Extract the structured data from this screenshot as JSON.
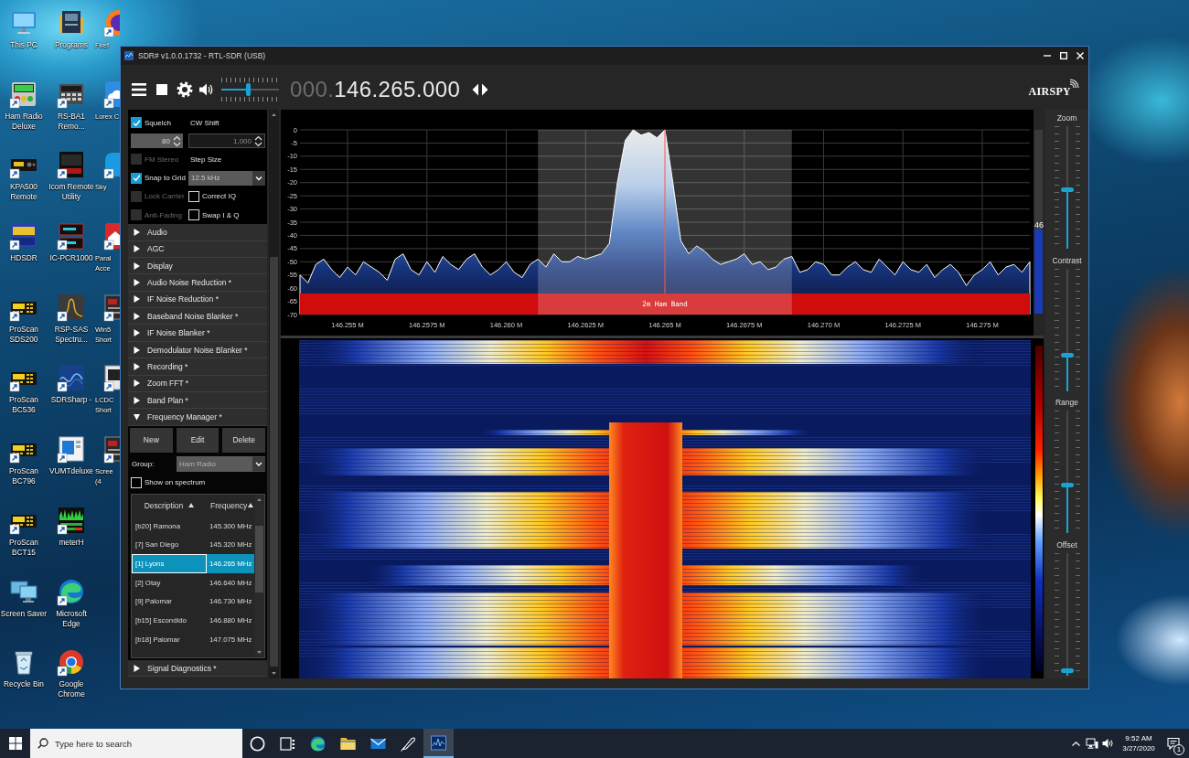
{
  "desktop": {
    "columns": [
      {
        "icons": [
          {
            "label": "This PC",
            "kind": "monitor",
            "shortcut": false
          },
          {
            "label": "Ham Radio Deluxe",
            "kind": "radio",
            "shortcut": true
          },
          {
            "label": "KPA500 Remote",
            "kind": "amplifier",
            "shortcut": true
          },
          {
            "label": "HDSDR",
            "kind": "hd_tile",
            "shortcut": true
          },
          {
            "label": "ProScan SDS200",
            "kind": "scanner",
            "shortcut": true
          },
          {
            "label": "ProScan BC536",
            "kind": "scanner",
            "shortcut": true
          },
          {
            "label": "ProScan BC796",
            "kind": "scanner",
            "shortcut": true
          },
          {
            "label": "ProScan BCT15",
            "kind": "scanner",
            "shortcut": true
          },
          {
            "label": "Screen Saver",
            "kind": "screens",
            "shortcut": false
          },
          {
            "label": "Recycle Bin",
            "kind": "bin",
            "shortcut": false
          }
        ]
      },
      {
        "icons": [
          {
            "label": "Programs",
            "kind": "folder",
            "shortcut": false
          },
          {
            "label": "RS-BA1 Remo...",
            "kind": "rack",
            "shortcut": true
          },
          {
            "label": "Icom Remote Utility",
            "kind": "remote_tile",
            "shortcut": true
          },
          {
            "label": "IC-PCR1000",
            "kind": "stack",
            "shortcut": true
          },
          {
            "label": "RSP-SAS Spectru...",
            "kind": "peak",
            "shortcut": true
          },
          {
            "label": "SDRSharp -",
            "kind": "wave",
            "shortcut": true
          },
          {
            "label": "VUMTdeluxe",
            "kind": "window",
            "shortcut": true
          },
          {
            "label": "meterH",
            "kind": "meter",
            "shortcut": true
          },
          {
            "label": "Microsoft Edge",
            "kind": "swirl",
            "shortcut": true
          },
          {
            "label": "Google Chrome",
            "kind": "ring",
            "shortcut": true
          }
        ]
      },
      {
        "icons": [
          {
            "label": "Firef",
            "kind": "fox",
            "shortcut": true
          },
          {
            "label": "Lorex C",
            "kind": "cloud",
            "shortcut": true
          },
          {
            "label": "Sky",
            "kind": "chat",
            "shortcut": true
          },
          {
            "label": "Paral Acce",
            "kind": "house",
            "shortcut": true
          },
          {
            "label": "Win5 Short",
            "kind": "dark",
            "shortcut": true
          },
          {
            "label": "LCDC Short",
            "kind": "lcd",
            "shortcut": true
          },
          {
            "label": "Scree (4",
            "kind": "dark",
            "shortcut": true
          }
        ]
      }
    ]
  },
  "window": {
    "title": "SDR# v1.0.0.1732 - RTL-SDR (USB)"
  },
  "toolbar": {
    "volume": {
      "level": 0.47
    },
    "frequency": {
      "prefix": "000.",
      "value": "146.265.000"
    },
    "logo": "AIRSPY"
  },
  "side_panel": {
    "demodulator": [
      {
        "kind": "checkbox",
        "label": "Squelch",
        "checked": true,
        "disabled": false
      },
      {
        "kind": "label",
        "text": "CW Shift"
      },
      {
        "kind": "spinner",
        "value": "80",
        "disabled": false
      },
      {
        "kind": "spinner",
        "value": "1,000",
        "disabled": true
      },
      {
        "kind": "checkbox",
        "label": "FM Stereo",
        "checked": false,
        "disabled": true
      },
      {
        "kind": "label",
        "text": "Step Size"
      },
      {
        "kind": "checkbox",
        "label": "Snap to Grid",
        "checked": true,
        "disabled": false
      },
      {
        "kind": "dropdown",
        "value": "12.5 kHz"
      },
      {
        "kind": "checkbox",
        "label": "Lock Carrier",
        "checked": false,
        "disabled": true
      },
      {
        "kind": "checkbox",
        "label": "Correct IQ",
        "checked": false,
        "disabled": false
      },
      {
        "kind": "checkbox",
        "label": "Anti-Fading",
        "checked": false,
        "disabled": true
      },
      {
        "kind": "checkbox",
        "label": "Swap I & Q",
        "checked": false,
        "disabled": false
      }
    ],
    "sections": [
      {
        "label": "Audio",
        "expanded": false
      },
      {
        "label": "AGC",
        "expanded": false
      },
      {
        "label": "Display",
        "expanded": false
      },
      {
        "label": "Audio Noise Reduction *",
        "expanded": false
      },
      {
        "label": "IF Noise Reduction *",
        "expanded": false
      },
      {
        "label": "Baseband Noise Blanker *",
        "expanded": false
      },
      {
        "label": "IF Noise Blanker *",
        "expanded": false
      },
      {
        "label": "Demodulator Noise Blanker *",
        "expanded": false
      },
      {
        "label": "Recording *",
        "expanded": false
      },
      {
        "label": "Zoom FFT *",
        "expanded": false
      },
      {
        "label": "Band Plan *",
        "expanded": false
      },
      {
        "label": "Frequency Manager *",
        "expanded": true,
        "body": {
          "buttons": [
            "New",
            "Edit",
            "Delete"
          ],
          "group": {
            "label": "Group:",
            "value": "Ham Radio"
          },
          "show_on_spectrum": {
            "label": "Show on spectrum",
            "checked": false
          },
          "table": {
            "columns": [
              {
                "label": "Description",
                "sorted": true
              },
              {
                "label": "Frequency",
                "sorted": true
              }
            ],
            "rows": [
              {
                "cells": [
                  "[b20] Ramona",
                  "145.300 MHz"
                ],
                "selected": false
              },
              {
                "cells": [
                  "[7] San Diego",
                  "145.320 MHz"
                ],
                "selected": false
              },
              {
                "cells": [
                  "[1] Lyons",
                  "146.265 MHz"
                ],
                "selected": true
              },
              {
                "cells": [
                  "[2] Otay",
                  "146.640 MHz"
                ],
                "selected": false
              },
              {
                "cells": [
                  "[9] Palomar",
                  "146.730 MHz"
                ],
                "selected": false
              },
              {
                "cells": [
                  "[b15] Escondido",
                  "146.880 MHz"
                ],
                "selected": false
              },
              {
                "cells": [
                  "[b18] Palomar",
                  "147.075 MHz"
                ],
                "selected": false
              }
            ]
          }
        }
      },
      {
        "label": "Signal Diagnostics *",
        "expanded": false
      }
    ]
  },
  "spectrum": {
    "chart_data": {
      "type": "area",
      "grid": true,
      "xlim": [
        146.2535,
        146.2765
      ],
      "ylim": [
        -70,
        0
      ],
      "xticks": [
        {
          "value": 146.255,
          "label": "146.255 M"
        },
        {
          "value": 146.2575,
          "label": "146.2575 M"
        },
        {
          "value": 146.26,
          "label": "146.260 M"
        },
        {
          "value": 146.2625,
          "label": "146.2625 M"
        },
        {
          "value": 146.265,
          "label": "146.265 M"
        },
        {
          "value": 146.2675,
          "label": "146.2675 M"
        },
        {
          "value": 146.27,
          "label": "146.270 M"
        },
        {
          "value": 146.2725,
          "label": "146.2725 M"
        },
        {
          "value": 146.275,
          "label": "146.275 M"
        }
      ],
      "yticks": [
        0,
        -5,
        -10,
        -15,
        -20,
        -25,
        -30,
        -35,
        -40,
        -45,
        -50,
        -55,
        -60,
        -65,
        -70
      ],
      "x": [
        146.2535,
        146.2535,
        146.25375,
        146.254,
        146.25425,
        146.2545,
        146.25475,
        146.255,
        146.25525,
        146.2555,
        146.25575,
        146.256,
        146.25625,
        146.2565,
        146.25675,
        146.257,
        146.25725,
        146.2575,
        146.25775,
        146.258,
        146.25825,
        146.2585,
        146.25875,
        146.259,
        146.25925,
        146.2595,
        146.25975,
        146.26,
        146.26025,
        146.2605,
        146.26075,
        146.261,
        146.26125,
        146.2615,
        146.26175,
        146.262,
        146.26225,
        146.2625,
        146.26275,
        146.263,
        146.26325,
        146.2635,
        146.26375,
        146.264,
        146.26425,
        146.2645,
        146.26475,
        146.265,
        146.26525,
        146.2655,
        146.26575,
        146.266,
        146.26625,
        146.2665,
        146.26675,
        146.267,
        146.26725,
        146.2675,
        146.26775,
        146.268,
        146.26825,
        146.2685,
        146.26875,
        146.269,
        146.26925,
        146.2695,
        146.26975,
        146.27,
        146.27025,
        146.2705,
        146.27075,
        146.271,
        146.27125,
        146.2715,
        146.27175,
        146.272,
        146.27225,
        146.2725,
        146.27275,
        146.273,
        146.27325,
        146.2735,
        146.27375,
        146.274,
        146.27425,
        146.2745,
        146.27475,
        146.275,
        146.27525,
        146.2755,
        146.27575,
        146.276,
        146.27625,
        146.2765,
        146.2765
      ],
      "series": [
        {
          "color": "#ffffff",
          "values": [
            -70,
            -55,
            -58,
            -51,
            -49,
            -53,
            -56,
            -52,
            -55,
            -50,
            -52,
            -54,
            -57,
            -49,
            -47,
            -53,
            -55,
            -50,
            -54,
            -48,
            -51,
            -53,
            -49,
            -47,
            -52,
            -55,
            -53,
            -50,
            -54,
            -56,
            -51,
            -49,
            -52,
            -47,
            -50,
            -50,
            -48,
            -49,
            -48,
            -47,
            -43,
            -20,
            -4,
            0,
            -2,
            -1,
            -3,
            0,
            -20,
            -42,
            -47,
            -44,
            -46,
            -49,
            -51,
            -50,
            -49,
            -47,
            -51,
            -50,
            -53,
            -52,
            -49,
            -48,
            -54,
            -53,
            -50,
            -51,
            -55,
            -55,
            -52,
            -50,
            -53,
            -54,
            -49,
            -52,
            -55,
            -50,
            -53,
            -54,
            -51,
            -56,
            -53,
            -51,
            -54,
            -59,
            -55,
            -53,
            -50,
            -55,
            -52,
            -51,
            -54,
            -50,
            -70
          ]
        }
      ],
      "ref_lines": [
        {
          "axis": "x",
          "value": 146.265
        }
      ],
      "bands": [
        {
          "axis": "x",
          "from": 146.261,
          "to": 146.269
        },
        {
          "axis": "y",
          "from": -70,
          "to": -62,
          "label": "2m Ham Band"
        }
      ]
    },
    "signal_meter": {
      "level": 0.46,
      "reading": "46"
    }
  },
  "view_sliders": [
    {
      "label": "Zoom",
      "level": 0.48
    },
    {
      "label": "Contrast",
      "level": 0.28
    },
    {
      "label": "Range",
      "level": 0.39
    },
    {
      "label": "Offset",
      "level": 0.02
    }
  ],
  "taskbar": {
    "search": {
      "placeholder": "Type here to search"
    },
    "buttons": [
      {
        "kind": "circle",
        "selected": false
      },
      {
        "kind": "task_view",
        "selected": false
      },
      {
        "kind": "swirl",
        "selected": false
      },
      {
        "kind": "folder",
        "selected": false
      },
      {
        "kind": "mail",
        "selected": false
      },
      {
        "kind": "feather",
        "selected": false
      },
      {
        "kind": "waveform_window",
        "selected": true
      }
    ],
    "time": "9:52 AM",
    "date": "3/27/2020",
    "notification_count": "1"
  }
}
